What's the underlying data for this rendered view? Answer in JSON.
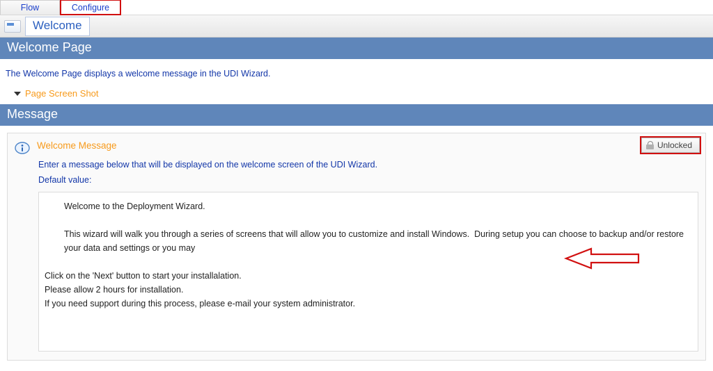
{
  "tabs": {
    "flow": "Flow",
    "configure": "Configure"
  },
  "subtab": {
    "label": "Welcome"
  },
  "sections": {
    "welcome_page": "Welcome Page",
    "message": "Message"
  },
  "welcome_description": "The Welcome Page displays a welcome message in the UDI Wizard.",
  "expander": {
    "page_screenshot": "Page Screen Shot"
  },
  "message_panel": {
    "title": "Welcome Message",
    "subtitle": "Enter a message below that will be displayed on the welcome screen of the UDI Wizard.",
    "default_label": "Default value:",
    "unlocked_label": "Unlocked",
    "body": {
      "p1": "Welcome to the Deployment Wizard.",
      "p2": "This wizard will walk you through a series of screens that will allow you to customize and install Windows.  During setup you can choose to backup and/or restore your data and settings or you may",
      "p3": "Click on the 'Next' button to start your installalation.",
      "p4": "Please allow 2 hours for installation.",
      "p5": "If you need support during this process, please e-mail your system administrator."
    }
  }
}
